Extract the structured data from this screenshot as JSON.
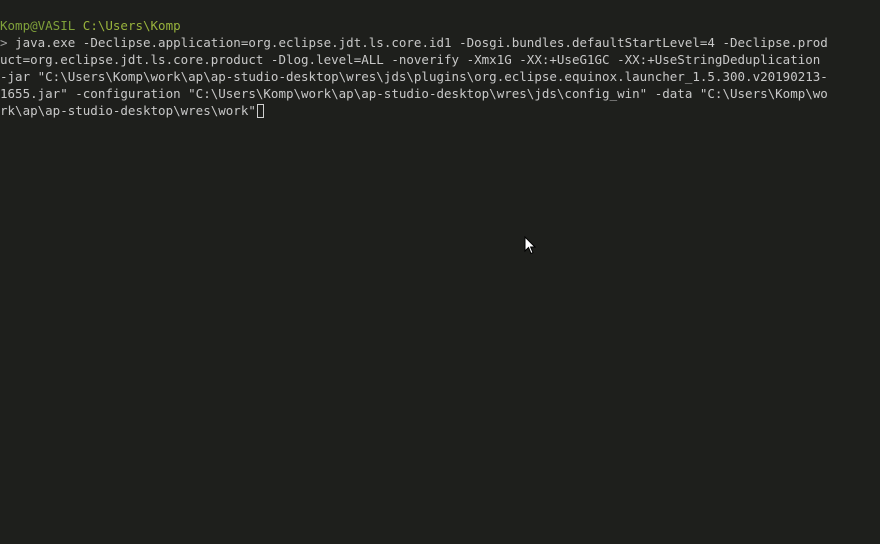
{
  "terminal": {
    "prompt": {
      "user_host": "Komp@VASIL",
      "cwd": "C:\\Users\\Komp",
      "symbol": ">"
    },
    "command_lines": [
      " java.exe -Declipse.application=org.eclipse.jdt.ls.core.id1 -Dosgi.bundles.defaultStartLevel=4 -Declipse.prod",
      "uct=org.eclipse.jdt.ls.core.product -Dlog.level=ALL -noverify -Xmx1G -XX:+UseG1GC -XX:+UseStringDeduplication",
      "-jar \"C:\\Users\\Komp\\work\\ap\\ap-studio-desktop\\wres\\jds\\plugins\\org.eclipse.equinox.launcher_1.5.300.v20190213-",
      "1655.jar\" -configuration \"C:\\Users\\Komp\\work\\ap\\ap-studio-desktop\\wres\\jds\\config_win\" -data \"C:\\Users\\Komp\\wo",
      "rk\\ap\\ap-studio-desktop\\wres\\work\""
    ],
    "colors": {
      "background": "#1e1f1c",
      "text": "#c8c8c8",
      "user_host": "#7fa13a",
      "cwd": "#98b23c"
    },
    "pointer_icon": "mouse-pointer-icon"
  }
}
